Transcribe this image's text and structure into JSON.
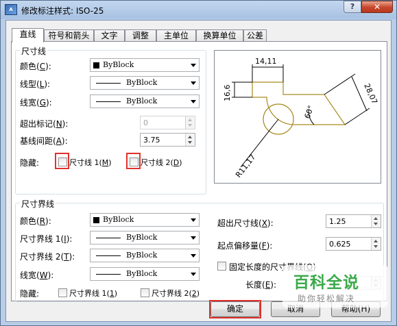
{
  "window": {
    "title": "修改标注样式: ISO-25",
    "app_icon_text": "A",
    "help_label": "?",
    "close_label": "✕"
  },
  "tabs": [
    "直线",
    "符号和箭头",
    "文字",
    "调整",
    "主单位",
    "换算单位",
    "公差"
  ],
  "dim_lines": {
    "group_title": "尺寸线",
    "color_label": "颜色(",
    "color_key": "C",
    "color_value": "ByBlock",
    "linetype_label": "线型(",
    "linetype_key": "L",
    "linetype_value": "ByBlock",
    "lineweight_label": "线宽(",
    "lineweight_key": "G",
    "lineweight_value": "ByBlock",
    "extend_ticks_label": "超出标记(",
    "extend_ticks_key": "N",
    "extend_ticks_value": "0",
    "baseline_spacing_label": "基线间距(",
    "baseline_spacing_key": "A",
    "baseline_spacing_value": "3.75",
    "suppress_label": "隐藏:",
    "suppress_1_label": "尺寸线 1(",
    "suppress_1_key": "M",
    "suppress_2_label": "尺寸线 2(",
    "suppress_2_key": "D"
  },
  "ext_lines": {
    "group_title": "尺寸界线",
    "color_label": "颜色(",
    "color_key": "R",
    "color_value": "ByBlock",
    "ext1_label": "尺寸界线 1(",
    "ext1_key": "I",
    "ext1_value": "ByBlock",
    "ext2_label": "尺寸界线 2(",
    "ext2_key": "T",
    "ext2_value": "ByBlock",
    "lineweight_label": "线宽(",
    "lineweight_key": "W",
    "lineweight_value": "ByBlock",
    "suppress_label": "隐藏:",
    "suppress_1_label": "尺寸界线 1(",
    "suppress_1_key": "1",
    "suppress_2_label": "尺寸界线 2(",
    "suppress_2_key": "2",
    "extend_beyond_label": "超出尺寸线(",
    "extend_beyond_key": "X",
    "extend_beyond_value": "1.25",
    "offset_label": "起点偏移量(",
    "offset_key": "F",
    "offset_value": "0.625",
    "fixed_length_label": "固定长度的尺寸界线(",
    "fixed_length_key": "O",
    "length_label": "长度(",
    "length_key": "E",
    "length_value": "1"
  },
  "preview": {
    "dim_top": "14,11",
    "dim_left": "16,6",
    "dim_right": "28,07",
    "dim_angle": "60°",
    "dim_radius": "R11,17"
  },
  "buttons": {
    "ok": "确定",
    "cancel": "取消",
    "help": "帮助(H)"
  },
  "watermark": {
    "big": "百科全说",
    "small": "助你轻松解决"
  },
  "colors": {
    "highlight": "#e0312b",
    "preview_shape": "#a88a1e"
  }
}
